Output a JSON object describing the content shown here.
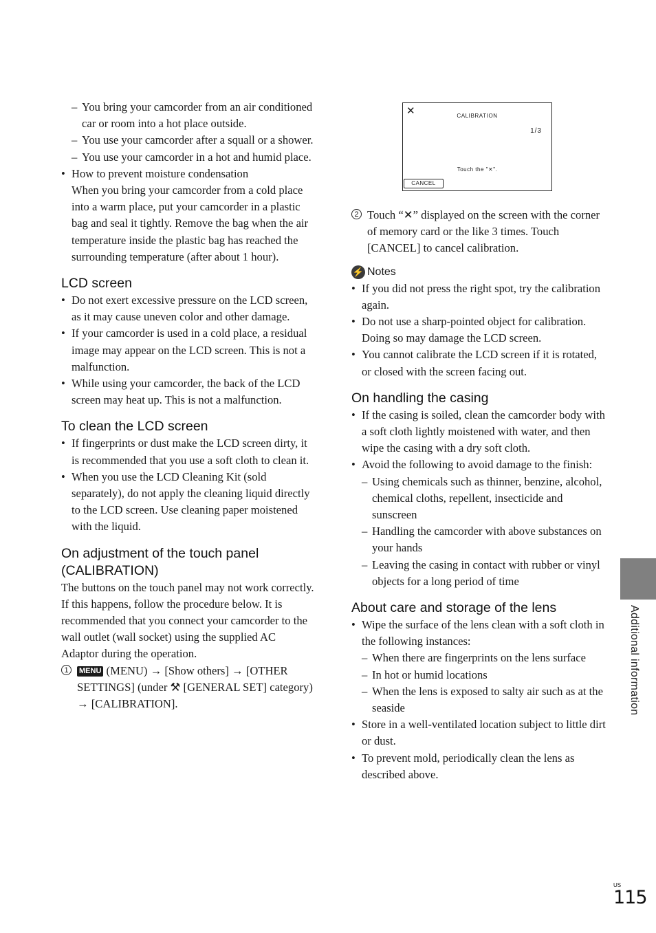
{
  "left_column": {
    "intro_dashes": [
      "You bring your camcorder from an air conditioned car or room into a hot place outside.",
      "You use your camcorder after a squall or a shower.",
      "You use your camcorder in a hot and humid place."
    ],
    "prevent_bullet": {
      "title": "How to prevent moisture condensation",
      "body": "When you bring your camcorder from a cold place into a warm place, put your camcorder in a plastic bag and seal it tightly. Remove the bag when the air temperature inside the plastic bag has reached the surrounding temperature (after about 1 hour)."
    },
    "lcd_screen": {
      "heading": "LCD screen",
      "bullets": [
        "Do not exert excessive pressure on the LCD screen, as it may cause uneven color and other damage.",
        "If your camcorder is used in a cold place, a residual image may appear on the LCD screen. This is not a malfunction.",
        "While using your camcorder, the back of the LCD screen may heat up. This is not a malfunction."
      ]
    },
    "clean_lcd": {
      "heading": "To clean the LCD screen",
      "bullets": [
        "If fingerprints or dust make the LCD screen dirty, it is recommended that you use a soft cloth to clean it.",
        "When you use the LCD Cleaning Kit (sold separately), do not apply the cleaning liquid directly to the LCD screen. Use cleaning paper moistened with the liquid."
      ]
    },
    "calibration": {
      "heading": "On adjustment of the touch panel (CALIBRATION)",
      "body": "The buttons on the touch panel may not work correctly. If this happens, follow the procedure below. It is recommended that you connect your camcorder to the wall outlet (wall socket) using the supplied AC Adaptor during the operation.",
      "step1": {
        "number": "1",
        "menu_badge": "MENU",
        "part1": "(MENU) → [Show others] → [OTHER SETTINGS] (under ",
        "wrench_icon": "⚒",
        "part2": " [GENERAL SET] category) → [CALIBRATION]."
      }
    }
  },
  "screen_figure": {
    "close_glyph": "✕",
    "title": "CALIBRATION",
    "page": "1/3",
    "instruction": "Touch the \"✕\".",
    "cancel_label": "CANCEL"
  },
  "right_column": {
    "step2": {
      "number": "2",
      "text": "Touch “✕” displayed on the screen with the corner of memory card or the like 3 times. Touch [CANCEL] to cancel calibration."
    },
    "notes": {
      "heading": "Notes",
      "bullets": [
        "If you did not press the right spot, try the calibration again.",
        "Do not use a sharp-pointed object for calibration. Doing so may damage the LCD screen.",
        "You cannot calibrate the LCD screen if it is rotated, or closed with the screen facing out."
      ]
    },
    "casing": {
      "heading": "On handling the casing",
      "bullets": [
        "If the casing is soiled, clean the camcorder body with a soft cloth lightly moistened with water, and then wipe the casing with a dry soft cloth.",
        "Avoid the following to avoid damage to the finish:"
      ],
      "dashes": [
        "Using chemicals such as thinner, benzine, alcohol, chemical cloths, repellent, insecticide and sunscreen",
        "Handling the camcorder with above substances on your hands",
        "Leaving the casing in contact with rubber or vinyl objects for a long period of time"
      ]
    },
    "lens": {
      "heading": "About care and storage of the lens",
      "bullet1": "Wipe the surface of the lens clean with a soft cloth in the following instances:",
      "dashes": [
        "When there are fingerprints on the lens surface",
        "In hot or humid locations",
        "When the lens is exposed to salty air such as at the seaside"
      ],
      "bullets_after": [
        "Store in a well-ventilated location subject to little dirt or dust.",
        "To prevent mold, periodically clean the lens as described above."
      ]
    }
  },
  "side_tab": {
    "label": "Additional information",
    "color": "#808080"
  },
  "footer": {
    "region": "US",
    "page_number": "115"
  },
  "markers": {
    "bullet": "•",
    "dash": "–"
  }
}
